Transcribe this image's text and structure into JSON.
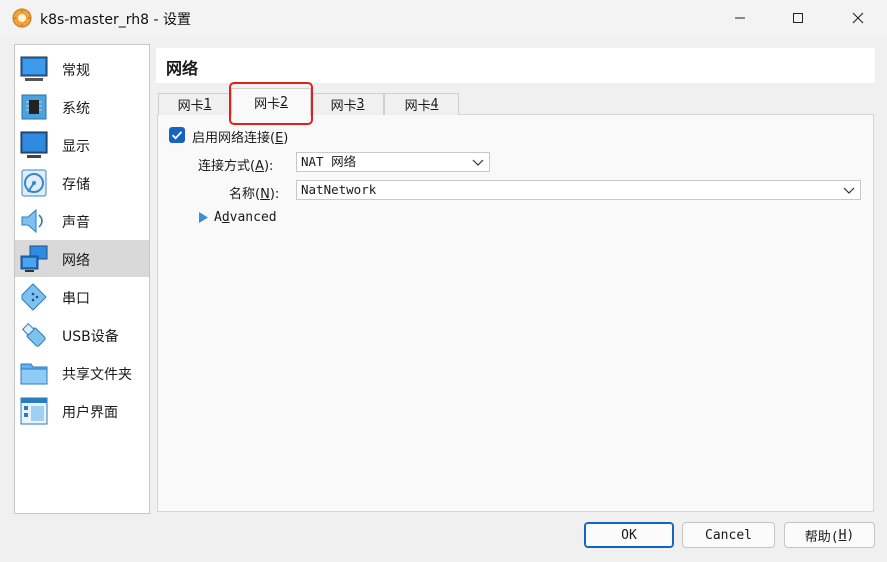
{
  "window": {
    "title": "k8s-master_rh8 - 设置"
  },
  "sidebar": {
    "items": [
      {
        "label": "常规",
        "icon": "general-icon"
      },
      {
        "label": "系统",
        "icon": "chip-icon"
      },
      {
        "label": "显示",
        "icon": "monitor-icon"
      },
      {
        "label": "存储",
        "icon": "disk-icon"
      },
      {
        "label": "声音",
        "icon": "speaker-icon"
      },
      {
        "label": "网络",
        "icon": "network-icon",
        "selected": true
      },
      {
        "label": "串口",
        "icon": "serial-port-icon"
      },
      {
        "label": "USB设备",
        "icon": "usb-icon"
      },
      {
        "label": "共享文件夹",
        "icon": "folder-icon"
      },
      {
        "label": "用户界面",
        "icon": "user-interface-icon"
      }
    ]
  },
  "section": {
    "title": "网络"
  },
  "tabs": [
    {
      "prefix": "网卡 ",
      "key": "1"
    },
    {
      "prefix": "网卡 ",
      "key": "2",
      "active": true
    },
    {
      "prefix": "网卡 ",
      "key": "3"
    },
    {
      "prefix": "网卡 ",
      "key": "4"
    }
  ],
  "adapter": {
    "enable_label_prefix": "启用网络连接(",
    "enable_label_key": "E",
    "enable_label_suffix": ")",
    "enabled": true,
    "attach_label_prefix": "连接方式(",
    "attach_label_key": "A",
    "attach_label_suffix": "):",
    "attach_value": "NAT 网络",
    "name_label_prefix": "名称(",
    "name_label_key": "N",
    "name_label_suffix": "):",
    "name_value": "NatNetwork",
    "advanced_key": "d",
    "advanced_prefix": "A",
    "advanced_suffix": "vanced"
  },
  "buttons": {
    "ok": "OK",
    "cancel": "Cancel",
    "help_prefix": "帮助(",
    "help_key": "H",
    "help_suffix": ")"
  },
  "colors": {
    "accent": "#1565c0",
    "highlight": "#e0201b"
  }
}
